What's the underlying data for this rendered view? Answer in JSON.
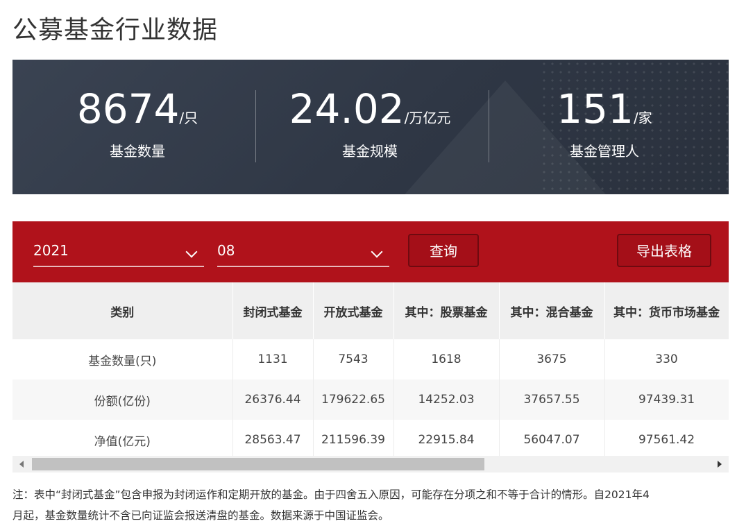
{
  "page": {
    "title": "公募基金行业数据"
  },
  "stats": [
    {
      "value": "8674",
      "unit": "/只",
      "label": "基金数量"
    },
    {
      "value": "24.02",
      "unit": "/万亿元",
      "label": "基金规模"
    },
    {
      "value": "151",
      "unit": "/家",
      "label": "基金管理人"
    }
  ],
  "filter": {
    "year": "2021",
    "month": "08",
    "query_label": "查询",
    "export_label": "导出表格"
  },
  "table": {
    "headers": [
      "类别",
      "封闭式基金",
      "开放式基金",
      "其中：股票基金",
      "其中：混合基金",
      "其中：货币市场基金"
    ],
    "rows": [
      [
        "基金数量(只)",
        "1131",
        "7543",
        "1618",
        "3675",
        "330"
      ],
      [
        "份额(亿份)",
        "26376.44",
        "179622.65",
        "14252.03",
        "37657.55",
        "97439.31"
      ],
      [
        "净值(亿元)",
        "28563.47",
        "211596.39",
        "22915.84",
        "56047.07",
        "97561.42"
      ]
    ]
  },
  "note": {
    "line1": "注：表中“封闭式基金”包含申报为封闭运作和定期开放的基金。由于四舍五入原因，可能存在分项之和不等于合计的情形。自2021年4",
    "line2": "月起，基金数量统计不含已向证监会报送清盘的基金。数据来源于中国证监会。"
  },
  "colors": {
    "accent": "#b0121b",
    "banner": "#343c4a"
  }
}
